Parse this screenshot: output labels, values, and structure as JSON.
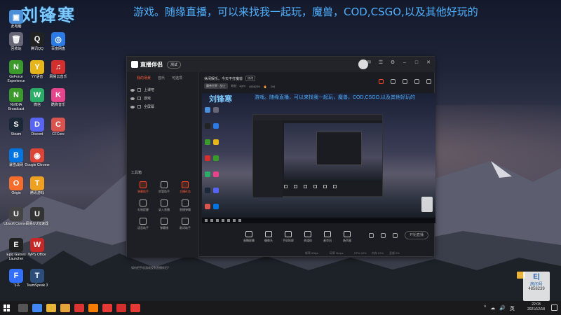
{
  "desktop": {
    "overlay_title": "刘锋寒",
    "overlay_scroll": "游戏。随缘直播，可以来找我一起玩，魔兽，COD,CSGO,以及其他好玩的",
    "icons": [
      {
        "label": "此电脑",
        "glyph": "▣",
        "color": "#4a8fd8"
      },
      {
        "label": "回收站",
        "glyph": "🗑",
        "color": "#667"
      },
      {
        "label": "腾讯QQ",
        "glyph": "Q",
        "color": "#222"
      },
      {
        "label": "百度网盘",
        "glyph": "◎",
        "color": "#2c7be5"
      },
      {
        "label": "GeForce Experience",
        "glyph": "N",
        "color": "#3a9a2a"
      },
      {
        "label": "YY语音",
        "glyph": "Y",
        "color": "#e6b51a"
      },
      {
        "label": "网易云音乐",
        "glyph": "♫",
        "color": "#d32f2f"
      },
      {
        "label": "NVIDIA Broadcast",
        "glyph": "N",
        "color": "#3a9a2a"
      },
      {
        "label": "微信",
        "glyph": "W",
        "color": "#2aae67"
      },
      {
        "label": "酷狗音乐",
        "glyph": "K",
        "color": "#e6458b"
      },
      {
        "label": "Steam",
        "glyph": "S",
        "color": "#1b2838"
      },
      {
        "label": "Discord",
        "glyph": "D",
        "color": "#5865f2"
      },
      {
        "label": "CFCore",
        "glyph": "C",
        "color": "#d9534f"
      },
      {
        "label": "暴雪战网",
        "glyph": "B",
        "color": "#0074e0"
      },
      {
        "label": "Google Chrome",
        "glyph": "◉",
        "color": "#db4437"
      },
      {
        "label": "Origin",
        "glyph": "O",
        "color": "#f56c2d"
      },
      {
        "label": "腾讯游戏",
        "glyph": "T",
        "color": "#f0a020"
      },
      {
        "label": "Ubisoft Connect",
        "glyph": "U",
        "color": "#444"
      },
      {
        "label": "网易UU加速器",
        "glyph": "U",
        "color": "#333"
      },
      {
        "label": "Epic Games Launcher",
        "glyph": "E",
        "color": "#222"
      },
      {
        "label": "WPS Office",
        "glyph": "W",
        "color": "#c62828"
      },
      {
        "label": "飞书",
        "glyph": "F",
        "color": "#3370ff"
      },
      {
        "label": "TeamSpeak 3",
        "glyph": "T",
        "color": "#2d4e7a"
      }
    ]
  },
  "app": {
    "logo_text": "直播伴侣",
    "version_label": "测试",
    "sidebar_tabs": [
      "我的场景",
      "音乐",
      "可选项"
    ],
    "scenes": [
      "上课吧",
      "游戏",
      "全屏幕"
    ],
    "tools_title": "工具箱",
    "tools": [
      {
        "label": "弹幕助手",
        "highlight": true
      },
      {
        "label": "房管助手",
        "highlight": false
      },
      {
        "label": "主播任务",
        "highlight": true
      },
      {
        "label": "礼物提醒",
        "highlight": false
      },
      {
        "label": "录入直播",
        "highlight": false
      },
      {
        "label": "直播弹幕",
        "highlight": false
      },
      {
        "label": "语音助手",
        "highlight": false
      },
      {
        "label": "弹幕播",
        "highlight": false
      },
      {
        "label": "歌词助手",
        "highlight": false
      }
    ],
    "sidebar_tip": "如何把手机游戏投到直播伴侣？",
    "room_title": "休闲娱乐。今天不打魔兽",
    "room_tag": "修改",
    "room_category": "魔兽世界 · 战士",
    "room_fans": "粉丝 · 1gen",
    "room_id": "4858239",
    "room_hot": "244",
    "preview": {
      "title": "刘锋寒",
      "scroll": "游戏。随缘直播，可以来找我一起玩，魔兽，COD,CSGO,以及其他好玩的"
    },
    "controls": [
      {
        "label": "直播屏幕",
        "icon": "screen-icon"
      },
      {
        "label": "摄像头",
        "icon": "camera-icon"
      },
      {
        "label": "手机投屏",
        "icon": "phone-icon"
      },
      {
        "label": "多媒体",
        "icon": "media-icon"
      },
      {
        "label": "麦克风",
        "icon": "mic-icon"
      },
      {
        "label": "扬声器",
        "icon": "speaker-icon"
      }
    ],
    "start_button": "开始直播",
    "status": [
      "帧率 60fps",
      "码率 0kbps",
      "CPU 40%",
      "内存 61%",
      "丢帧 0%"
    ]
  },
  "stamp": {
    "logo": "E|",
    "name": "房间号",
    "id": "4858239"
  },
  "taskbar": {
    "time": "22:03",
    "date": "2021/12/18",
    "tray": [
      "^",
      "☁",
      "🔊",
      "英"
    ],
    "apps": [
      "#555",
      "#4285f4",
      "#e8b43a",
      "#e6a23c",
      "#d33",
      "#f57c00",
      "#e53935",
      "#d32f2f",
      "#e53935"
    ]
  },
  "colors": {
    "accent": "#ff5a3c",
    "overlay_blue": "#4fb0ff"
  }
}
